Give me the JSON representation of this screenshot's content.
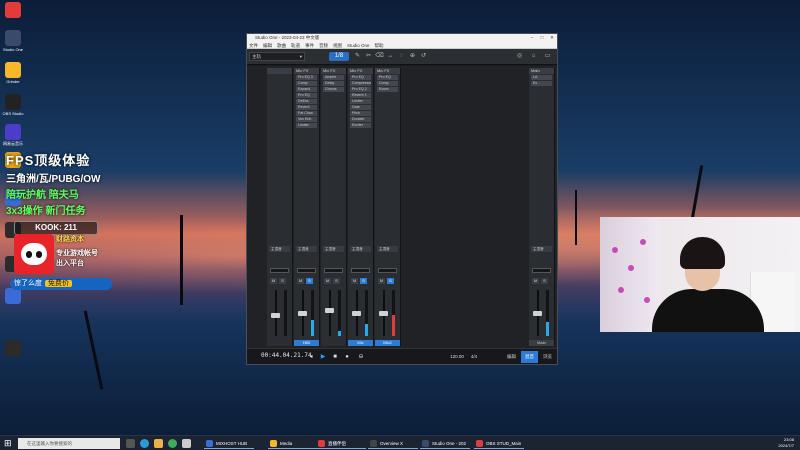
{
  "desktop_icons": [
    {
      "label": "",
      "color": "#e23b3b"
    },
    {
      "label": "Studio One",
      "color": "#3a4a6a"
    },
    {
      "label": "Grinder",
      "color": "#f5b82a"
    },
    {
      "label": "OBS Studio",
      "color": "#222222"
    },
    {
      "label": "网易云音乐",
      "color": "#4c3cc8"
    },
    {
      "label": "",
      "color": "#e8a21b"
    },
    {
      "label": "",
      "color": "#3b6bd6"
    },
    {
      "label": "",
      "color": "#2b2b2b"
    },
    {
      "label": "",
      "color": "#2b2b2b"
    },
    {
      "label": "",
      "color": "#3b6bd6"
    },
    {
      "label": "",
      "color": "#2b2b2b"
    }
  ],
  "overlay": {
    "title": "FPS顶级体验",
    "games": "三角洲/瓦/PUBG/OW",
    "line3": "陪玩护航 陪夫马",
    "line4": "3x3操作 新门任务",
    "kook": "KOOK: 211",
    "promo_top": "财路资本",
    "promo_mid": "专业游戏帐号",
    "promo_bot": "出入平台",
    "bar_text": "惊了么度",
    "bar_highlight": "免费价"
  },
  "window": {
    "title": "Studio One - 2023-04-23 中文版",
    "menu": [
      "文件",
      "编辑",
      "歌曲",
      "轨道",
      "事件",
      "音频",
      "视图",
      "Studio One",
      "帮助"
    ],
    "preset": "主轨",
    "tool_blue": "1/8",
    "tool_labels": [
      "✎",
      "✂",
      "⌫",
      "↔",
      "◌",
      "⊕",
      "↺"
    ]
  },
  "strips": [
    {
      "name": "",
      "inserts": [],
      "io": "主混音",
      "bottom": "",
      "bottom_blue": false,
      "level": 0,
      "fader": 0.5,
      "red": false
    },
    {
      "name": "Mic FX",
      "inserts": [
        "Pro EQ 3",
        "Comp",
        "Expand",
        "Pro EQ",
        "DeEss",
        "Reverb",
        "Fat Chan",
        "Vox Enh",
        "Limiter"
      ],
      "io": "主混音",
      "bottom": "HiDi",
      "bottom_blue": true,
      "level": 0.35,
      "fader": 0.45,
      "red": false
    },
    {
      "name": "Mic FX",
      "inserts": [
        "Ampire",
        "Delay",
        "Chorus"
      ],
      "io": "主混音",
      "bottom": "",
      "bottom_blue": false,
      "level": 0.1,
      "fader": 0.4,
      "red": false
    },
    {
      "name": "Mic FX",
      "inserts": [
        "Pro EQ",
        "Compressor",
        "Pro EQ 2",
        "Reverb 1",
        "Limiter",
        "Gate",
        "Pitch",
        "Doubler",
        "Exciter"
      ],
      "io": "主混音",
      "bottom": "Mic",
      "bottom_blue": true,
      "level": 0.25,
      "fader": 0.45,
      "red": false
    },
    {
      "name": "Mic FX",
      "inserts": [
        "Pro EQ",
        "Comp",
        "Room"
      ],
      "io": "主混音",
      "bottom": "Mic2",
      "bottom_blue": true,
      "level": 0.45,
      "fader": 0.45,
      "red": true
    },
    {
      "name": "Main",
      "inserts": [
        "LA",
        "Ex"
      ],
      "io": "主混音",
      "bottom": "Main",
      "bottom_blue": false,
      "level": 0.3,
      "fader": 0.45,
      "red": false
    }
  ],
  "transport": {
    "time": "00:44.04.21.74",
    "tempo": "120.00",
    "sig": "4/4",
    "tabs": [
      "编辑",
      "混音",
      "浏览"
    ]
  },
  "taskbar": {
    "search": "在这里输入你要搜索的",
    "apps": [
      {
        "label": "MIXHOST HUB",
        "color": "#3b6bd6"
      },
      {
        "label": "Media",
        "color": "#f5b82a"
      },
      {
        "label": "直播伴侣",
        "color": "#e23b3b"
      },
      {
        "label": "Overview X",
        "color": "#444444"
      },
      {
        "label": "Studio One - 202",
        "color": "#3a4a6a"
      },
      {
        "label": "OBS STUD_Main",
        "color": "#e23b3b"
      }
    ],
    "clock_time": "23:08",
    "clock_date": "2024/7/7"
  }
}
